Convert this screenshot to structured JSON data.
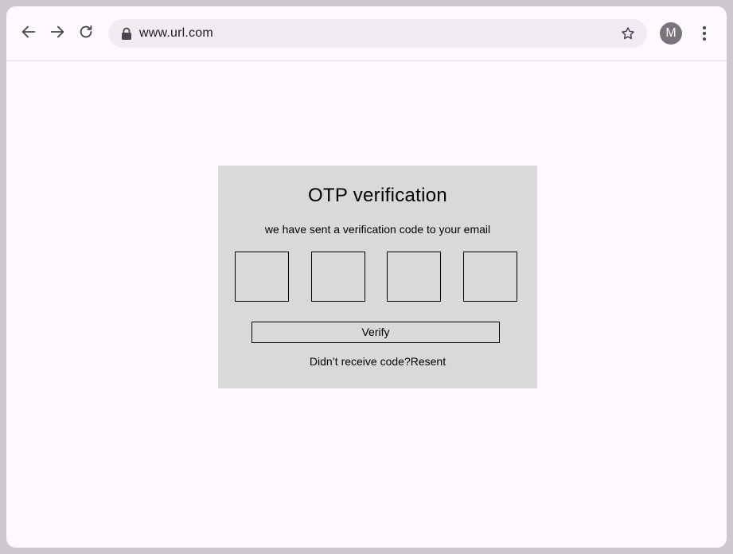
{
  "browser": {
    "url": "www.url.com",
    "profile_initial": "M",
    "icons": {
      "back": "arrow-left-icon",
      "forward": "arrow-right-icon",
      "reload": "reload-icon",
      "lock": "lock-icon",
      "bookmark": "star-icon",
      "menu": "more-vertical-icon"
    }
  },
  "otp": {
    "title": "OTP verification",
    "subtitle": "we have sent a verification code to your email",
    "digits": [
      "",
      "",
      "",
      ""
    ],
    "verify_label": "Verify",
    "resend_prompt": "Didn’t receive code?",
    "resend_link": "Resent"
  },
  "colors": {
    "page_background": "#fff8ff",
    "card_background": "#d9d9d9",
    "omnibox_background": "#f1ecf4",
    "frame": "#cdc7d0",
    "avatar": "#79747e"
  }
}
